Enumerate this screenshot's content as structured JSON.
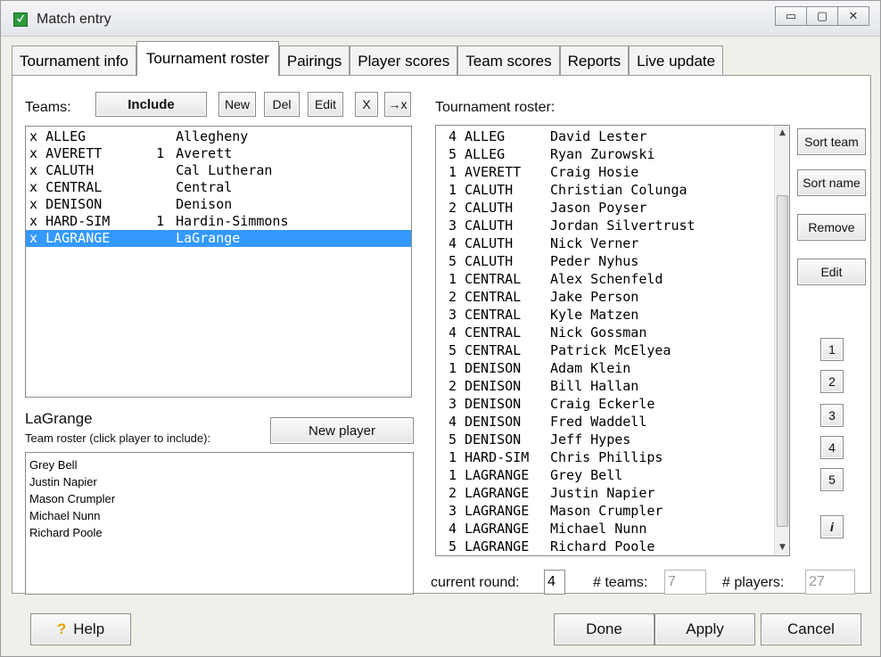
{
  "window": {
    "title": "Match entry",
    "minimize_glyph": "▭",
    "maximize_glyph": "▢",
    "close_glyph": "✕"
  },
  "tabs": [
    {
      "label": "Tournament info"
    },
    {
      "label": "Tournament roster",
      "active": true
    },
    {
      "label": "Pairings"
    },
    {
      "label": "Player scores"
    },
    {
      "label": "Team scores"
    },
    {
      "label": "Reports"
    },
    {
      "label": "Live update"
    }
  ],
  "teams": {
    "label": "Teams:",
    "include_label": "Include",
    "new_label": "New",
    "del_label": "Del",
    "edit_label": "Edit",
    "x_label": "X",
    "arrow_x_label": "→x",
    "rows": [
      {
        "mark": "x",
        "code": "ALLEG",
        "num": "",
        "name": "Allegheny"
      },
      {
        "mark": "x",
        "code": "AVERETT",
        "num": "1",
        "name": "Averett"
      },
      {
        "mark": "x",
        "code": "CALUTH",
        "num": "",
        "name": "Cal Lutheran"
      },
      {
        "mark": "x",
        "code": "CENTRAL",
        "num": "",
        "name": "Central"
      },
      {
        "mark": "x",
        "code": "DENISON",
        "num": "",
        "name": "Denison"
      },
      {
        "mark": "x",
        "code": "HARD-SIM",
        "num": "1",
        "name": "Hardin-Simmons"
      },
      {
        "mark": "x",
        "code": "LAGRANGE",
        "num": "",
        "name": "LaGrange",
        "selected": true
      }
    ]
  },
  "team_roster": {
    "team_name": "LaGrange",
    "instruction": "Team roster (click player to include):",
    "new_player_label": "New player",
    "players": [
      "Grey Bell",
      "Justin Napier",
      "Mason Crumpler",
      "Michael Nunn",
      "Richard Poole"
    ]
  },
  "tournament_roster": {
    "label": "Tournament roster:",
    "rows": [
      {
        "n": "4",
        "team": "ALLEG",
        "player": "David Lester"
      },
      {
        "n": "5",
        "team": "ALLEG",
        "player": "Ryan Zurowski"
      },
      {
        "n": "1",
        "team": "AVERETT",
        "player": "Craig Hosie"
      },
      {
        "n": "1",
        "team": "CALUTH",
        "player": "Christian Colunga"
      },
      {
        "n": "2",
        "team": "CALUTH",
        "player": "Jason Poyser"
      },
      {
        "n": "3",
        "team": "CALUTH",
        "player": "Jordan Silvertrust"
      },
      {
        "n": "4",
        "team": "CALUTH",
        "player": "Nick Verner"
      },
      {
        "n": "5",
        "team": "CALUTH",
        "player": "Peder Nyhus"
      },
      {
        "n": "1",
        "team": "CENTRAL",
        "player": "Alex Schenfeld"
      },
      {
        "n": "2",
        "team": "CENTRAL",
        "player": "Jake Person"
      },
      {
        "n": "3",
        "team": "CENTRAL",
        "player": "Kyle Matzen"
      },
      {
        "n": "4",
        "team": "CENTRAL",
        "player": "Nick Gossman"
      },
      {
        "n": "5",
        "team": "CENTRAL",
        "player": "Patrick McElyea"
      },
      {
        "n": "1",
        "team": "DENISON",
        "player": "Adam Klein"
      },
      {
        "n": "2",
        "team": "DENISON",
        "player": "Bill Hallan"
      },
      {
        "n": "3",
        "team": "DENISON",
        "player": "Craig Eckerle"
      },
      {
        "n": "4",
        "team": "DENISON",
        "player": "Fred Waddell"
      },
      {
        "n": "5",
        "team": "DENISON",
        "player": "Jeff Hypes"
      },
      {
        "n": "1",
        "team": "HARD-SIM",
        "player": "Chris Phillips"
      },
      {
        "n": "1",
        "team": "LAGRANGE",
        "player": "Grey Bell"
      },
      {
        "n": "2",
        "team": "LAGRANGE",
        "player": "Justin Napier"
      },
      {
        "n": "3",
        "team": "LAGRANGE",
        "player": "Mason Crumpler"
      },
      {
        "n": "4",
        "team": "LAGRANGE",
        "player": "Michael Nunn"
      },
      {
        "n": "5",
        "team": "LAGRANGE",
        "player": "Richard Poole"
      }
    ],
    "sort_team_label": "Sort team",
    "sort_name_label": "Sort name",
    "remove_label": "Remove",
    "edit_label": "Edit",
    "number_buttons": [
      "1",
      "2",
      "3",
      "4",
      "5"
    ],
    "i_label": "i"
  },
  "footer_fields": {
    "current_round_label": "current round:",
    "current_round_value": "4",
    "teams_label": "# teams:",
    "teams_value": "7",
    "players_label": "# players:",
    "players_value": "27"
  },
  "buttons": {
    "help_label": "Help",
    "done_label": "Done",
    "apply_label": "Apply",
    "cancel_label": "Cancel"
  }
}
